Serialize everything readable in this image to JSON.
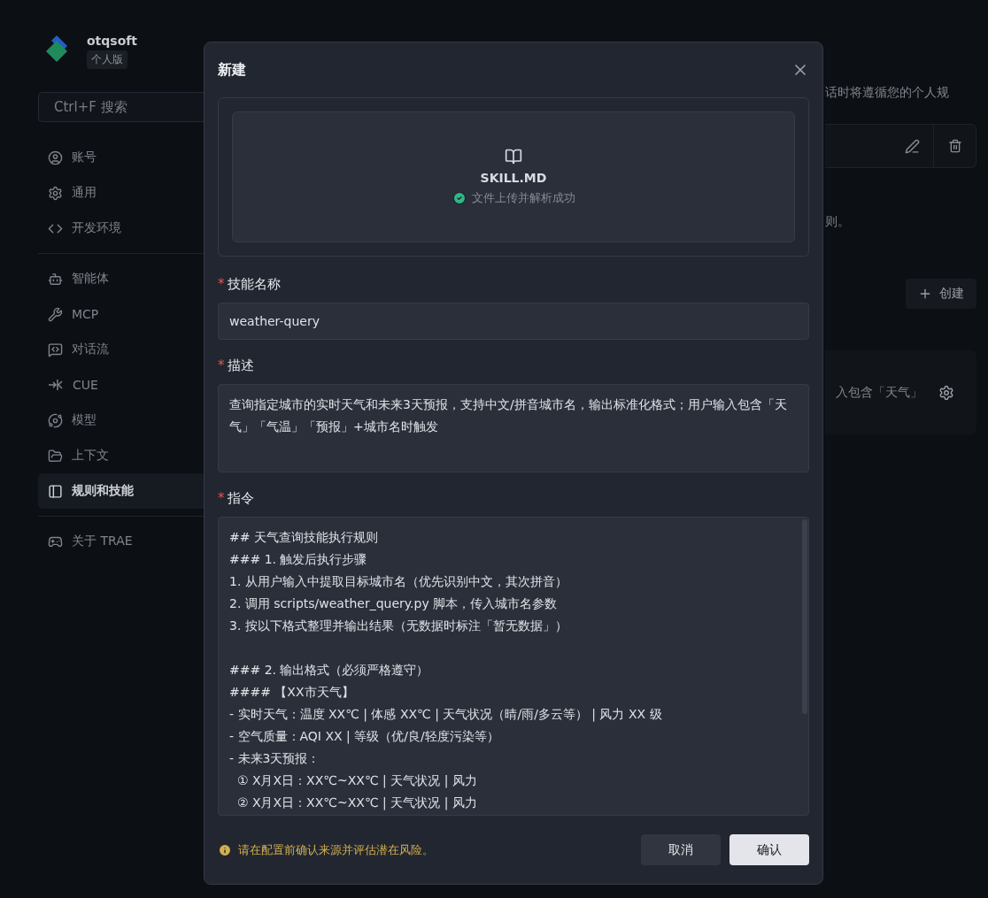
{
  "brand": {
    "name": "otqsoft",
    "edition": "个人版"
  },
  "sidebar": {
    "search": {
      "placeholder": "Ctrl+F 搜索"
    },
    "groups": [
      [
        {
          "label": "账号",
          "selected": false
        },
        {
          "label": "通用",
          "selected": false
        },
        {
          "label": "开发环境",
          "selected": false
        }
      ],
      [
        {
          "label": "智能体",
          "selected": false
        },
        {
          "label": "MCP",
          "selected": false
        },
        {
          "label": "对话流",
          "selected": false
        },
        {
          "label": "CUE",
          "selected": false
        },
        {
          "label": "模型",
          "selected": false
        },
        {
          "label": "上下文",
          "selected": false
        },
        {
          "label": "规则和技能",
          "selected": true
        }
      ],
      [
        {
          "label": "关于 TRAE",
          "selected": false
        }
      ]
    ]
  },
  "page": {
    "description_fragment": "话时将遵循您的个人规",
    "note_fragment": "则。",
    "create_button": "创建",
    "skill_description_fragment": "入包含「天气」"
  },
  "dialog": {
    "title": "新建",
    "upload": {
      "file_name": "SKILL.MD",
      "status": "文件上传并解析成功"
    },
    "fields": [
      {
        "label": "技能名称",
        "marker": "*",
        "kind": "input",
        "value": "weather-query"
      },
      {
        "label": "描述",
        "marker": "*",
        "kind": "textarea",
        "value": "查询指定城市的实时天气和未来3天预报，支持中文/拼音城市名，输出标准化格式；用户输入包含「天气」「气温」「预报」+城市名时触发"
      },
      {
        "label": "指令",
        "marker": "*",
        "kind": "code",
        "value": "## 天气查询技能执行规则\n### 1. 触发后执行步骤\n1. 从用户输入中提取目标城市名（优先识别中文，其次拼音）\n2. 调用 scripts/weather_query.py 脚本，传入城市名参数\n3. 按以下格式整理并输出结果（无数据时标注「暂无数据」）\n\n### 2. 输出格式（必须严格遵守）\n#### 【XX市天气】\n- 实时天气：温度 XX℃ | 体感 XX℃ | 天气状况（晴/雨/多云等） | 风力 XX 级\n- 空气质量：AQI XX | 等级（优/良/轻度污染等）\n- 未来3天预报：\n  ① X月X日：XX℃~XX℃ | 天气状况 | 风力\n  ② X月X日：XX℃~XX℃ | 天气状况 | 风力"
      }
    ],
    "warning": "请在配置前确认来源并评估潜在风险。",
    "buttons": [
      {
        "label": "取消",
        "kind": "secondary"
      },
      {
        "label": "确认",
        "kind": "primary"
      }
    ]
  }
}
